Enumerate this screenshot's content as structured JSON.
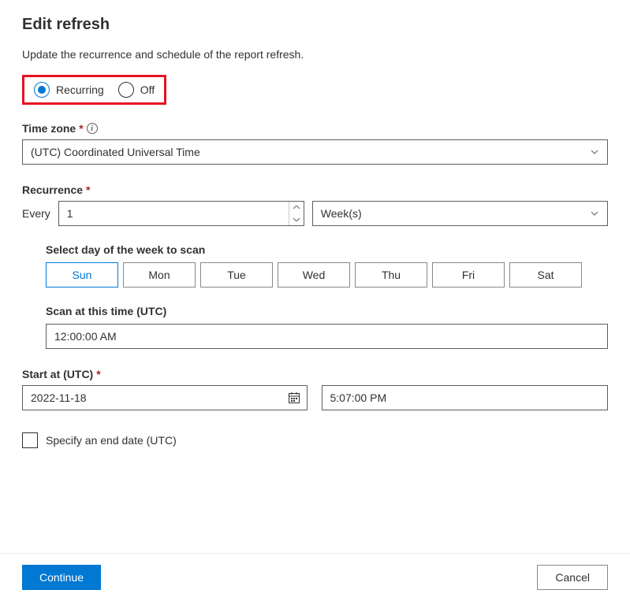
{
  "title": "Edit refresh",
  "subtitle": "Update the recurrence and schedule of the report refresh.",
  "radio": {
    "recurring": "Recurring",
    "off": "Off"
  },
  "timezone": {
    "label": "Time zone",
    "value": "(UTC) Coordinated Universal Time"
  },
  "recurrence": {
    "label": "Recurrence",
    "every": "Every",
    "count": "1",
    "unit": "Week(s)"
  },
  "days": {
    "label": "Select day of the week to scan",
    "items": [
      "Sun",
      "Mon",
      "Tue",
      "Wed",
      "Thu",
      "Fri",
      "Sat"
    ],
    "selected": "Sun"
  },
  "scanTime": {
    "label": "Scan at this time (UTC)",
    "value": "12:00:00 AM"
  },
  "startAt": {
    "label": "Start at (UTC)",
    "date": "2022-11-18",
    "time": "5:07:00 PM"
  },
  "endDate": {
    "label": "Specify an end date (UTC)"
  },
  "footer": {
    "continue": "Continue",
    "cancel": "Cancel"
  }
}
